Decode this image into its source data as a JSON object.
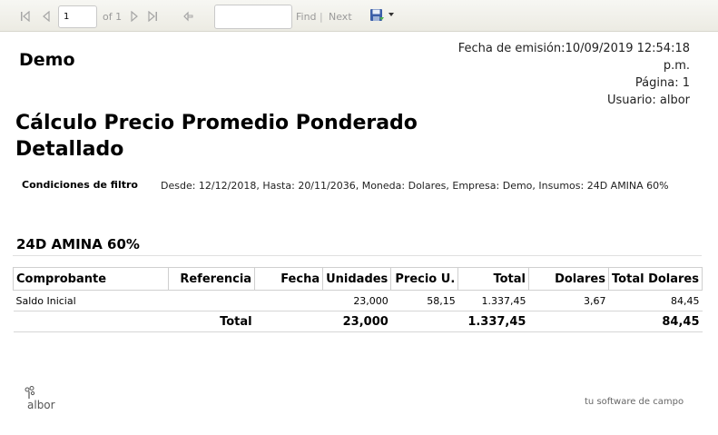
{
  "toolbar": {
    "page_value": "1",
    "page_of": "of 1",
    "find_placeholder": "",
    "find_label": "Find",
    "separator": "|",
    "next_label": "Next"
  },
  "report": {
    "company": "Demo",
    "issue_date": "Fecha de emisión:10/09/2019 12:54:18",
    "issue_ampm": "p.m.",
    "page": "Página: 1",
    "user": "Usuario: albor",
    "title_line1": "Cálculo Precio Promedio Ponderado",
    "title_line2": "Detallado",
    "filter_label": "Condiciones de filtro",
    "filter_text": "Desde: 12/12/2018, Hasta: 20/11/2036, Moneda: Dolares, Empresa: Demo, Insumos: 24D AMINA 60%",
    "group_title": "24D AMINA 60%"
  },
  "table": {
    "headers": [
      "Comprobante",
      "Referencia",
      "Fecha",
      "Unidades",
      "Precio U.",
      "Total",
      "Dolares",
      "Total Dolares"
    ],
    "rows": [
      [
        "Saldo Inicial",
        "",
        "",
        "23,000",
        "58,15",
        "1.337,45",
        "3,67",
        "84,45"
      ]
    ],
    "total_row": [
      "",
      "Total",
      "",
      "23,000",
      "",
      "1.337,45",
      "",
      "84,45"
    ]
  },
  "footer": {
    "brand": "albor",
    "tagline": "tu software de campo"
  },
  "icons": {
    "first": "first-page-icon",
    "prev": "previous-page-icon",
    "next": "next-page-icon",
    "last": "last-page-icon",
    "back": "back-to-parent-icon",
    "export": "save-disk-icon",
    "dropdown": "chevron-down-icon"
  }
}
